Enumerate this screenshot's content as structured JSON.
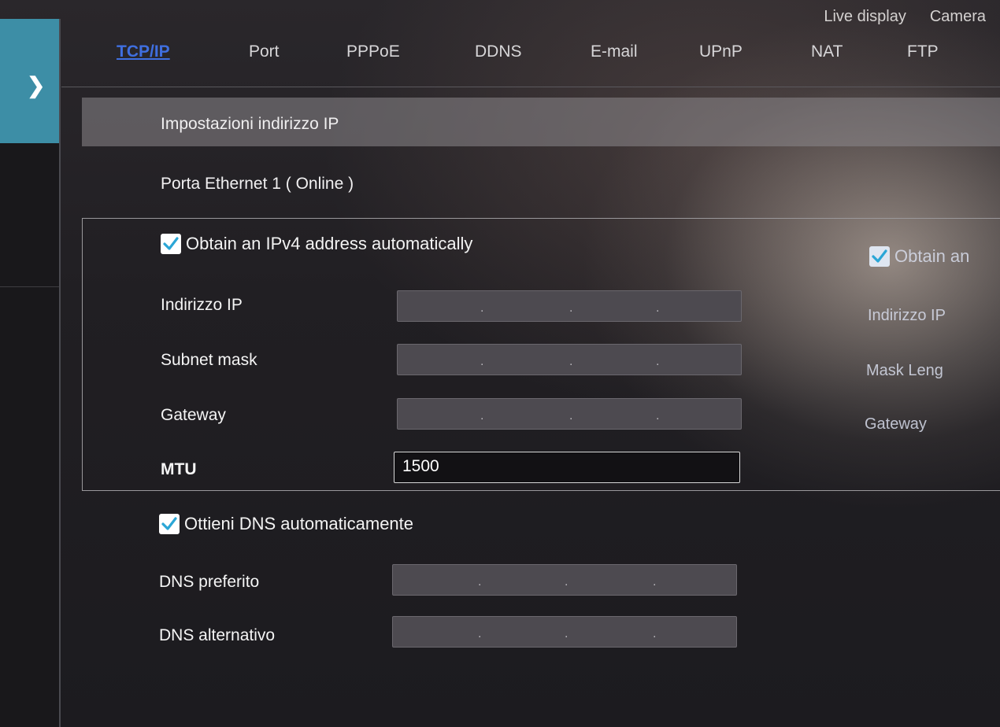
{
  "top_menu": [
    "Live display",
    "Camera"
  ],
  "tabs": [
    {
      "label": "TCP/IP",
      "active": true
    },
    {
      "label": "Port",
      "active": false
    },
    {
      "label": "PPPoE",
      "active": false
    },
    {
      "label": "DDNS",
      "active": false
    },
    {
      "label": "E-mail",
      "active": false
    },
    {
      "label": "UPnP",
      "active": false
    },
    {
      "label": "NAT",
      "active": false
    },
    {
      "label": "FTP",
      "active": false
    }
  ],
  "section_title": "Impostazioni indirizzo IP",
  "port_label": "Porta Ethernet 1 ( Online )",
  "ipv4": {
    "auto_label": "Obtain an IPv4 address automatically",
    "auto_checked": true,
    "ip_label": "Indirizzo IP",
    "subnet_label": "Subnet mask",
    "gateway_label": "Gateway",
    "mtu_label": "MTU",
    "mtu_value": "1500"
  },
  "ipv6": {
    "auto_label": "Obtain an",
    "auto_checked": true,
    "ip_label": "Indirizzo IP",
    "mask_label": "Mask Leng",
    "gateway_label": "Gateway"
  },
  "dns": {
    "auto_label": "Ottieni DNS automaticamente",
    "auto_checked": true,
    "preferred_label": "DNS preferito",
    "alternate_label": "DNS alternativo"
  },
  "colors": {
    "accent_tab": "#3f6fe0",
    "sidebar_active": "#3d8ea6",
    "checkbox_check": "#2aa6d6"
  },
  "icons": {
    "sidebar": "chevron-right-icon",
    "checkbox": "checkmark-icon"
  }
}
